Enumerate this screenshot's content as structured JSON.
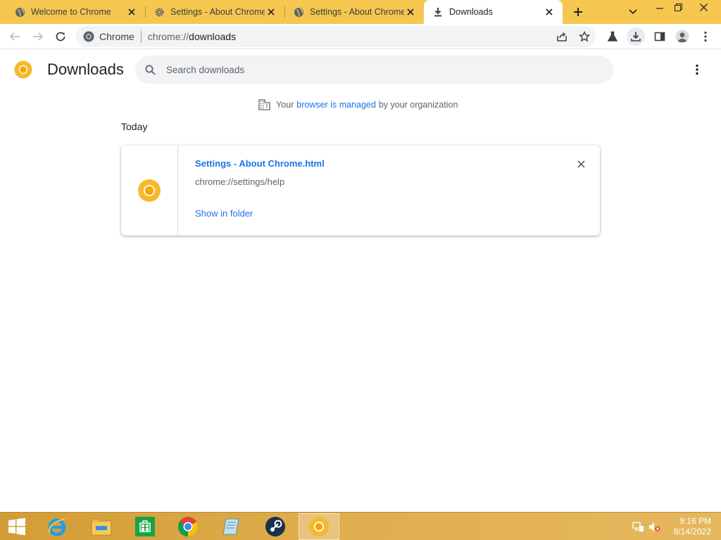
{
  "tabs": [
    {
      "title": "Welcome to Chrome",
      "icon": "globe-icon",
      "active": false
    },
    {
      "title": "Settings - About Chrome",
      "icon": "gear-icon",
      "active": false
    },
    {
      "title": "Settings - About Chrome",
      "icon": "globe-icon",
      "active": false
    },
    {
      "title": "Downloads",
      "icon": "download-icon",
      "active": true
    }
  ],
  "omnibox": {
    "site_label": "Chrome",
    "url_scheme": "chrome://",
    "url_host": "downloads"
  },
  "page": {
    "title": "Downloads",
    "search_placeholder": "Search downloads",
    "managed_prefix": "Your",
    "managed_link": "browser is managed",
    "managed_suffix": "by your organization",
    "date_group": "Today"
  },
  "downloads": [
    {
      "file_name": "Settings - About Chrome.html",
      "source_url": "chrome://settings/help",
      "action": "Show in folder"
    }
  ],
  "taskbar": {
    "items": [
      "start-button",
      "internet-explorer",
      "file-explorer",
      "windows-store",
      "google-chrome",
      "notepad",
      "steam",
      "chrome-canary"
    ],
    "clock_time": "9:16 PM",
    "clock_date": "8/14/2022"
  },
  "colors": {
    "tab_strip": "#f5c74f",
    "link": "#1a73e8",
    "taskbar": "#dfad4d"
  }
}
